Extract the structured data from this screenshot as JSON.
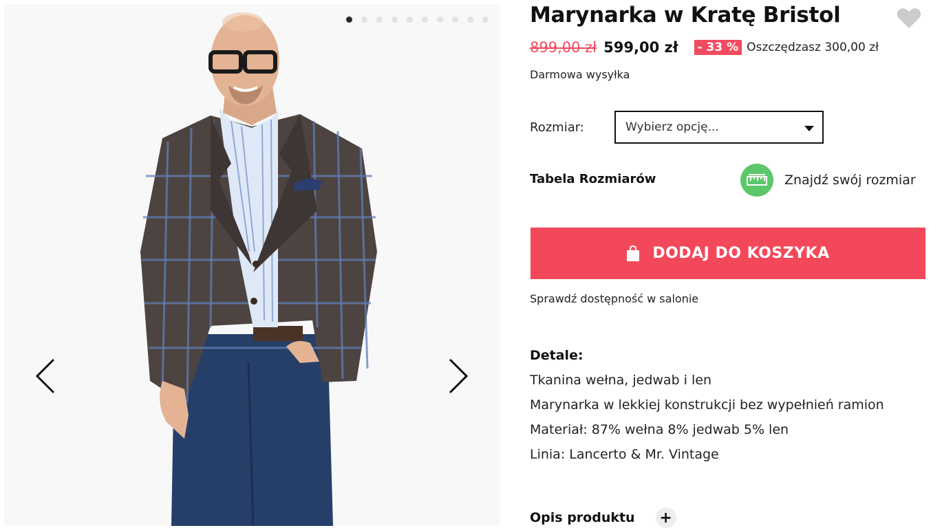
{
  "product": {
    "title": "Marynarka w Kratę Bristol",
    "old_price": "899,00 zł",
    "new_price": "599,00 zł",
    "discount_badge": "- 33 %",
    "savings_text": "Oszczędzasz 300,00 zł",
    "shipping_text": "Darmowa wysyłka"
  },
  "gallery": {
    "dot_count": 10,
    "active_index": 0
  },
  "size": {
    "label": "Rozmiar:",
    "selected": "Wybierz opcję..."
  },
  "size_table_link": "Tabela Rozmiarów",
  "find_size_link": "Znajdź swój rozmiar",
  "cart_button_label": "DODAJ DO KOSZYKA",
  "availability_link": "Sprawdź dostępność w salonie",
  "details": {
    "title": "Detale:",
    "items": [
      "Tkanina wełna, jedwab i len",
      "Marynarka w lekkiej konstrukcji bez wypełnień ramion",
      "Materiał: 87% wełna 8% jedwab 5% len",
      "Linia: Lancerto & Mr. Vintage"
    ]
  },
  "description_toggle": {
    "label": "Opis produktu",
    "icon": "+"
  },
  "colors": {
    "accent": "#f2485a",
    "find_size_icon_bg": "#5cc76b",
    "heart_icon": "#cccccc"
  }
}
